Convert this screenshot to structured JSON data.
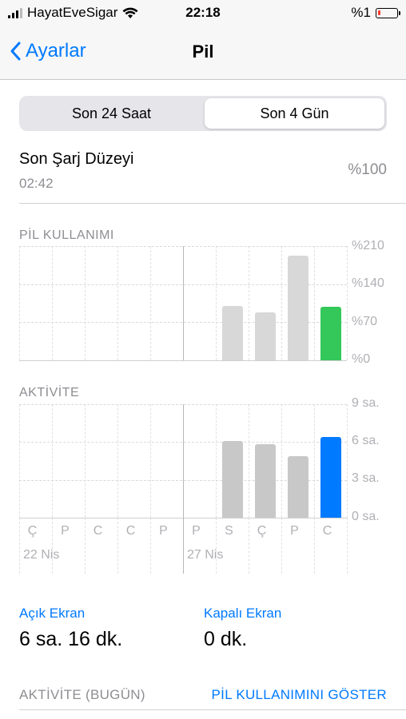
{
  "status_bar": {
    "carrier": "HayatEveSigar",
    "time": "22:18",
    "battery_text": "%1"
  },
  "nav": {
    "back_label": "Ayarlar",
    "title": "Pil"
  },
  "segmented": {
    "left": "Son 24 Saat",
    "right": "Son 4 Gün",
    "selected": "right"
  },
  "last_charge": {
    "title": "Son Şarj Düzeyi",
    "time": "02:42",
    "value": "%100"
  },
  "battery_usage": {
    "label": "PİL KULLANIMI",
    "ticks": [
      "%210",
      "%140",
      "%70",
      "%0"
    ]
  },
  "activity": {
    "label": "AKTİVİTE",
    "ticks": [
      "9 sa.",
      "6 sa.",
      "3 sa.",
      "0 sa."
    ]
  },
  "x_labels": [
    "Ç",
    "P",
    "C",
    "C",
    "P",
    "P",
    "S",
    "Ç",
    "P",
    "C"
  ],
  "dates": [
    "22 Nis",
    "27 Nis"
  ],
  "stats": {
    "screen_on_label": "Açık Ekran",
    "screen_on_value": "6 sa. 16 dk.",
    "screen_off_label": "Kapalı Ekran",
    "screen_off_value": "0 dk."
  },
  "footer": {
    "left": "AKTİVİTE (BUGÜN)",
    "right": "PİL KULLANIMINI GÖSTER"
  },
  "colors": {
    "accent": "#007aff",
    "battery_today": "#34c759",
    "activity_today": "#007aff",
    "battery_past": "#d8d8d8",
    "activity_past": "#c8c8c8"
  },
  "chart_data": [
    {
      "type": "bar",
      "title": "PİL KULLANIMI",
      "categories": [
        "Ç",
        "P",
        "C",
        "C",
        "P",
        "P",
        "S",
        "Ç",
        "P",
        "C"
      ],
      "values": [
        0,
        0,
        0,
        0,
        0,
        0,
        100,
        88,
        193,
        98
      ],
      "ylim": [
        0,
        210
      ],
      "yticks": [
        "%0",
        "%70",
        "%140",
        "%210"
      ]
    },
    {
      "type": "bar",
      "title": "AKTİVİTE",
      "categories": [
        "Ç",
        "P",
        "C",
        "C",
        "P",
        "P",
        "S",
        "Ç",
        "P",
        "C"
      ],
      "values": [
        0,
        0,
        0,
        0,
        0,
        0,
        6.1,
        5.8,
        4.9,
        6.4
      ],
      "ylim": [
        0,
        9
      ],
      "yticks": [
        "0 sa.",
        "3 sa.",
        "6 sa.",
        "9 sa."
      ]
    }
  ]
}
